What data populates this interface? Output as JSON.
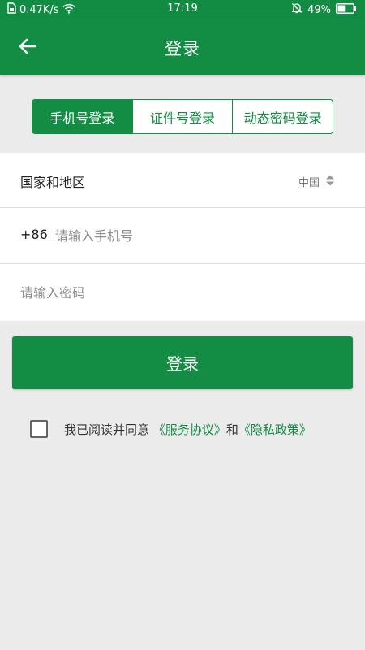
{
  "status_bar": {
    "network_speed": "0.47K/s",
    "time": "17:19",
    "battery": "49%",
    "battery_level": 0.49,
    "icons": [
      "sim-icon",
      "wifi-icon",
      "mute-bell-icon",
      "battery-icon"
    ]
  },
  "header": {
    "title": "登录",
    "back_icon": "arrow-left-icon"
  },
  "tabs": [
    {
      "label": "手机号登录",
      "active": true
    },
    {
      "label": "证件号登录",
      "active": false
    },
    {
      "label": "动态密码登录",
      "active": false
    }
  ],
  "form": {
    "country": {
      "label": "国家和地区",
      "value": "中国",
      "icon": "sort-arrows-icon"
    },
    "phone": {
      "code": "+86",
      "value": "",
      "placeholder": "请输入手机号"
    },
    "password": {
      "value": "",
      "placeholder": "请输入密码"
    }
  },
  "login_button": {
    "label": "登录"
  },
  "agreement": {
    "checked": false,
    "prefix": "我已阅读并同意",
    "terms": "《服务协议》",
    "and": "和",
    "privacy": "《隐私政策》"
  },
  "colors": {
    "primary": "#128d43",
    "background": "#ebebeb",
    "surface": "#ffffff"
  }
}
